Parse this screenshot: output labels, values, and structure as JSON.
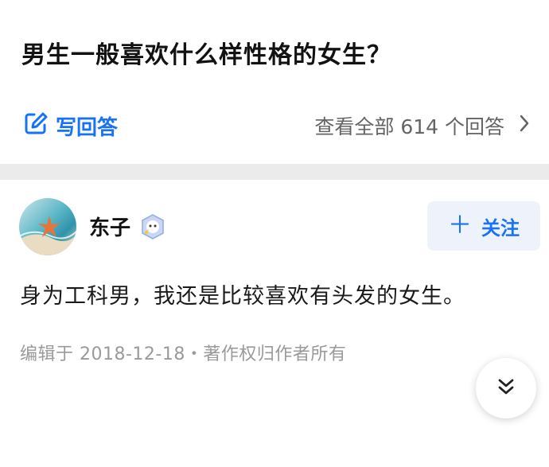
{
  "question": {
    "title": "男生一般喜欢什么样性格的女生？"
  },
  "answer_bar": {
    "write_label": "写回答",
    "view_all_label": "查看全部 614 个回答",
    "write_icon": "edit-icon",
    "chevron_icon": "chevron-right-icon"
  },
  "answer": {
    "author": {
      "name": "东子",
      "avatar": "starfish-beach-avatar",
      "badge_icon": "verified-badge-icon"
    },
    "follow_label": "关注",
    "follow_icon": "plus-icon",
    "text": "身为工科男，我还是比较喜欢有头发的女生。",
    "meta": "编辑于 2018-12-18・著作权归作者所有"
  },
  "collapse_icon": "double-chevron-down-icon",
  "colors": {
    "accent": "#1772f6",
    "divider": "#ebebeb",
    "meta_text": "#9a9a9a",
    "follow_bg": "#eef3fb"
  }
}
